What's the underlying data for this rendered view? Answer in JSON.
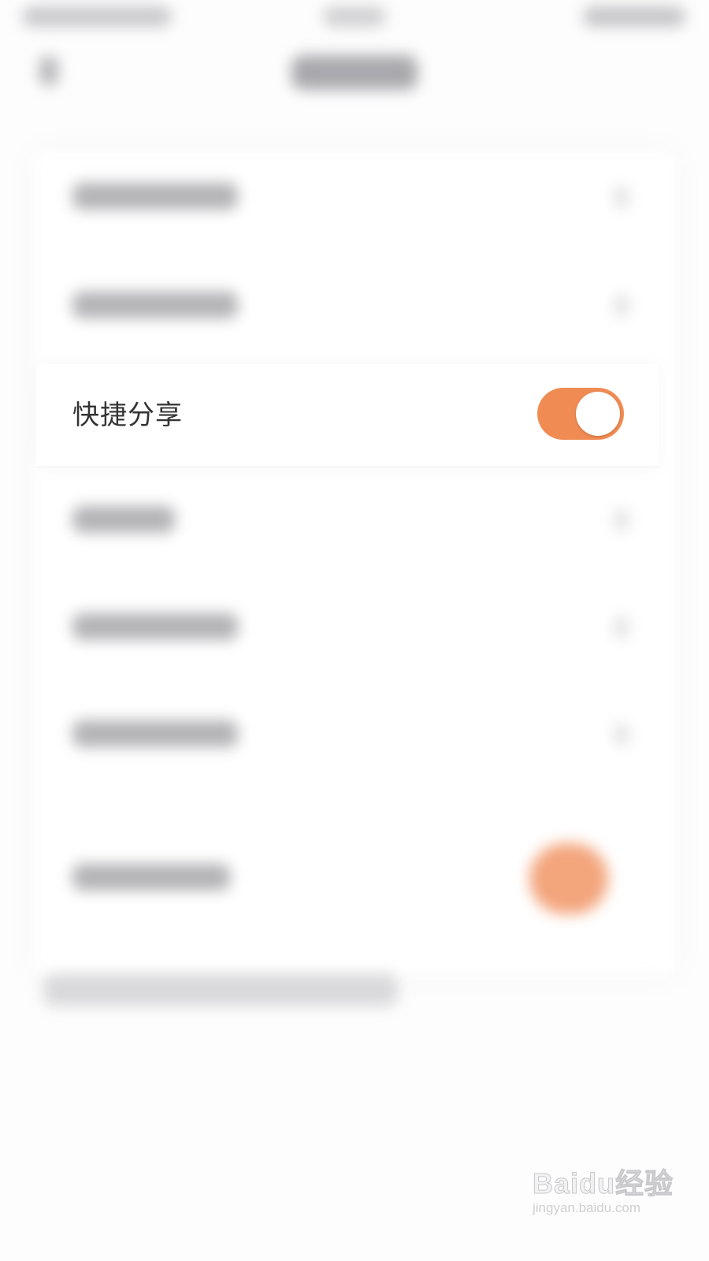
{
  "settings_row": {
    "label": "快捷分享",
    "toggle_on": true
  },
  "colors": {
    "toggle_accent": "#f08c53",
    "text_primary": "#333333",
    "background": "#fdfdfd"
  },
  "watermark": {
    "brand": "Baidu经验",
    "url": "jingyan.baidu.com"
  },
  "icons": {
    "back": "chevron-left-icon",
    "row_chevron": "chevron-right-icon"
  }
}
